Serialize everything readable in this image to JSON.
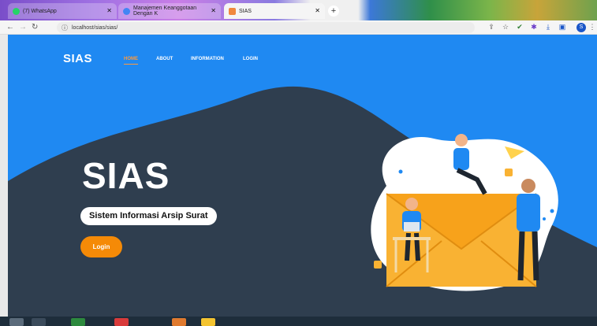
{
  "browser": {
    "tabs": [
      {
        "label": "(7) WhatsApp",
        "favicon": "whatsapp-icon"
      },
      {
        "label": "Manajemen Keanggotaan Dengan K",
        "favicon": "google-icon"
      },
      {
        "label": "SIAS",
        "favicon": "page-icon"
      }
    ],
    "address": "localhost/sias/sias/",
    "profile_initial": "S"
  },
  "site": {
    "brand": "SIAS",
    "nav": [
      "HOME",
      "ABOUT",
      "INFORMATION",
      "LOGIN"
    ],
    "active_nav": "HOME",
    "hero_title": "SIAS",
    "hero_subtitle": "Sistem Informasi Arsip Surat",
    "login_button": "Login"
  },
  "colors": {
    "page_blue": "#1f89f2",
    "dark_wave": "#2f3e4f",
    "accent_orange": "#f58a07"
  }
}
